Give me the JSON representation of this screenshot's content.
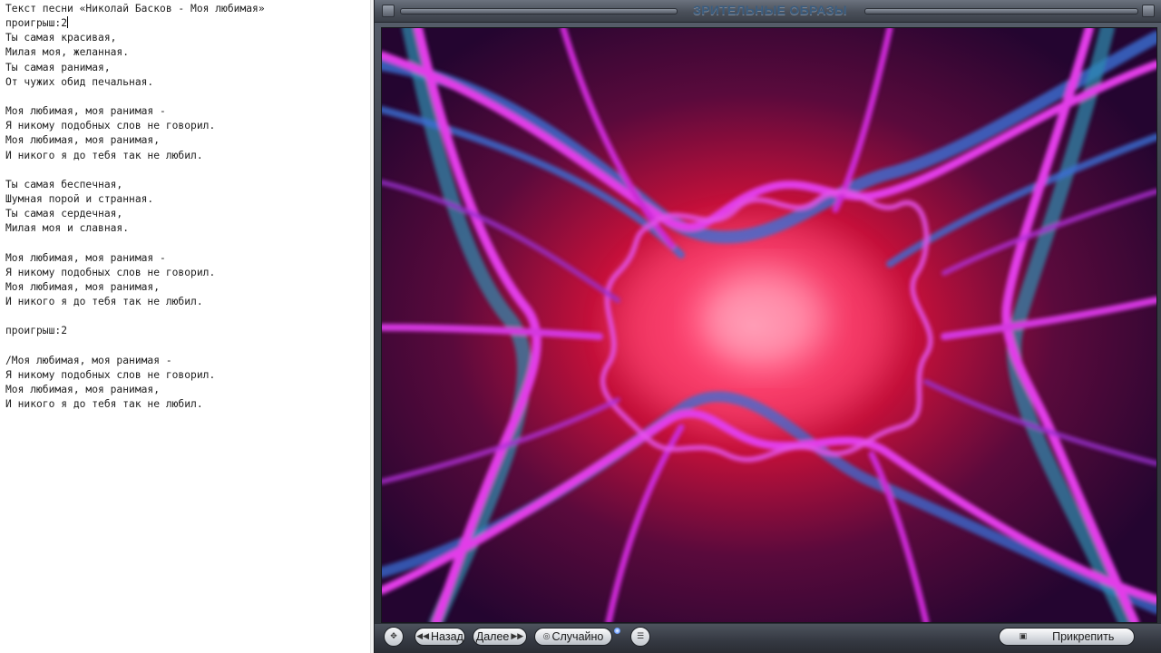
{
  "editor": {
    "lines": [
      "Текст песни «Николай Басков - Моя любимая»",
      "проигрыш:2",
      "Ты самая красивая,",
      "Милая моя, желанная.",
      "Ты самая ранимая,",
      "От чужих обид печальная.",
      "",
      "Моя любимая, моя ранимая -",
      "Я никому подобных слов не говорил.",
      "Моя любимая, моя ранимая,",
      "И никого я до тебя так не любил.",
      "",
      "Ты самая беспечная,",
      "Шумная порой и странная.",
      "Ты самая сердечная,",
      "Милая моя и славная.",
      "",
      "Моя любимая, моя ранимая -",
      "Я никому подобных слов не говорил.",
      "Моя любимая, моя ранимая,",
      "И никого я до тебя так не любил.",
      "",
      "проигрыш:2",
      "",
      "/Моя любимая, моя ранимая -",
      "Я никому подобных слов не говорил.",
      "Моя любимая, моя ранимая,",
      "И никого я до тебя так не любил."
    ]
  },
  "viz_window": {
    "title": "ЗРИТЕЛЬНЫЕ ОБРАЗЫ",
    "controls": {
      "back_label": "Назад",
      "next_label": "Далее",
      "random_label": "Случайно",
      "attach_label": "Прикрепить"
    }
  },
  "colors": {
    "title_text": "#3a5c7e",
    "viz_magenta": "#e23ce8",
    "viz_blue": "#3b6fd6",
    "viz_red": "#d81c3c"
  },
  "icons": [
    "move-icon",
    "back-arrows-icon",
    "next-arrows-icon",
    "random-icon",
    "list-menu-icon",
    "attach-icon",
    "minimize-icon",
    "close-icon"
  ]
}
